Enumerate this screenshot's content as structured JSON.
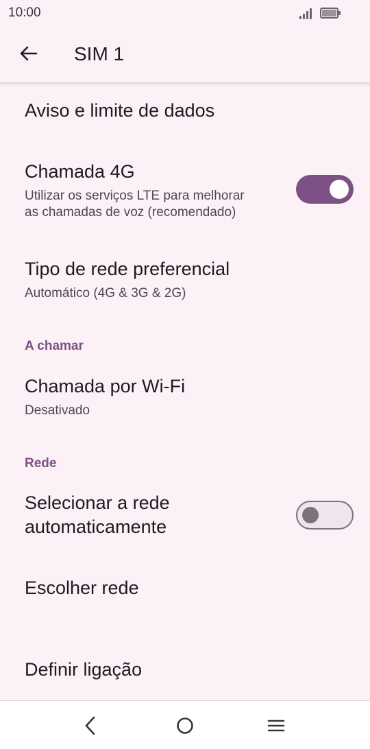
{
  "status_bar": {
    "time": "10:00",
    "signal_icon": "signal-icon",
    "battery_icon": "battery-icon"
  },
  "app_bar": {
    "title": "SIM 1",
    "back_icon": "back-arrow-icon"
  },
  "items": {
    "data_warning": {
      "title": "Aviso e limite de dados"
    },
    "call_4g": {
      "title": "Chamada 4G",
      "summary_line1": "Utilizar os serviços LTE para melhorar",
      "summary_line2": "as chamadas de voz (recomendado)",
      "toggle": "on"
    },
    "preferred_network": {
      "title": "Tipo de rede preferencial",
      "summary": "Automático (4G & 3G & 2G)"
    },
    "section_calling": "A chamar",
    "wifi_calling": {
      "title": "Chamada por Wi-Fi",
      "summary": "Desativado"
    },
    "section_network": "Rede",
    "auto_select": {
      "title_line1": "Selecionar a rede",
      "title_line2": "automaticamente",
      "toggle": "off"
    },
    "choose_network": {
      "title": "Escolher rede"
    },
    "apn": {
      "title": "Definir ligação"
    }
  },
  "colors": {
    "accent": "#7d5185",
    "background": "#fcf1f6",
    "text": "#1f1a1f",
    "secondary_text": "#4f464f"
  },
  "nav_bar": {
    "back_icon": "nav-back-icon",
    "home_icon": "nav-home-icon",
    "menu_icon": "nav-menu-icon"
  }
}
